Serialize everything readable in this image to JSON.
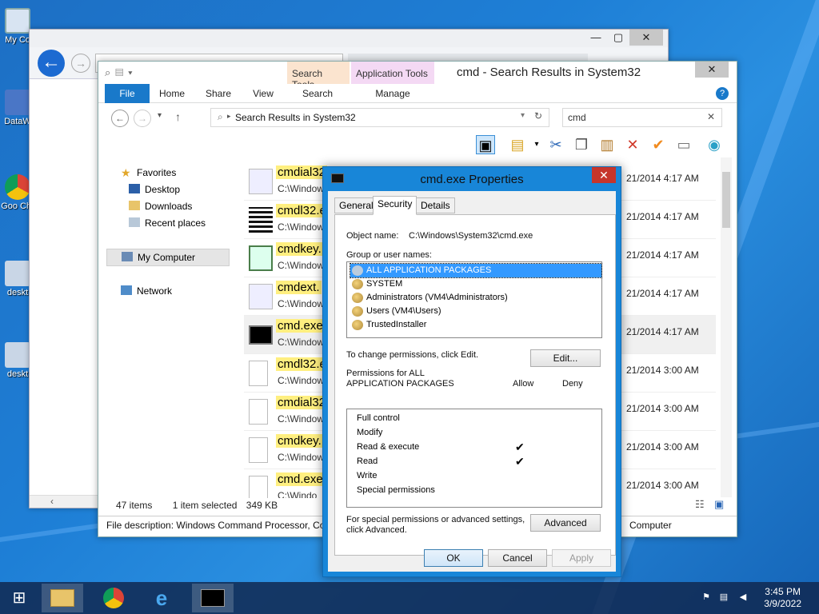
{
  "desktop": {
    "icons": [
      {
        "label": "My Co",
        "icon": "computer-icon"
      },
      {
        "label": "DataW",
        "icon": "datawarehouse-icon"
      },
      {
        "label": "Goo Chr",
        "icon": "chrome-icon"
      },
      {
        "label": "deskt",
        "icon": "desktop-file-icon"
      },
      {
        "label": "deskt",
        "icon": "desktop-file-icon"
      }
    ]
  },
  "browser": {
    "back_icon": "arrow-left-icon",
    "forward_icon": "arrow-right-icon"
  },
  "explorer": {
    "window_title": "cmd - Search Results in System32",
    "context_tabs": {
      "search_tools": "Search Tools",
      "application_tools": "Application Tools"
    },
    "ribbon_tabs": [
      "File",
      "Home",
      "Share",
      "View",
      "Search",
      "Manage"
    ],
    "address": "Search Results in System32",
    "search_value": "cmd",
    "nav": {
      "favorites": "Favorites",
      "desktop": "Desktop",
      "downloads": "Downloads",
      "recent": "Recent places",
      "my_computer": "My Computer",
      "network": "Network"
    },
    "files": [
      {
        "name": "cmdial32",
        "path": "C:\\Window",
        "date": "21/2014 4:17 AM",
        "icon": "gear-file-icon"
      },
      {
        "name": "cmdl32.e",
        "path": "C:\\Window",
        "date": "21/2014 4:17 AM",
        "icon": "phone-book-icon"
      },
      {
        "name": "cmdkey.",
        "path": "C:\\Window",
        "date": "21/2014 4:17 AM",
        "icon": "key-window-icon"
      },
      {
        "name": "cmdext.",
        "path": "C:\\Window",
        "date": "21/2014 4:17 AM",
        "icon": "gear-file-icon"
      },
      {
        "name": "cmd.exe",
        "path": "C:\\Window",
        "date": "21/2014 4:17 AM",
        "icon": "console-icon"
      },
      {
        "name": "cmdl32.e",
        "path": "C:\\Window",
        "date": "21/2014 3:00 AM",
        "icon": "blank-file-icon"
      },
      {
        "name": "cmdial32",
        "path": "C:\\Window",
        "date": "21/2014 3:00 AM",
        "icon": "blank-file-icon"
      },
      {
        "name": "cmdkey.",
        "path": "C:\\Window",
        "date": "21/2014 3:00 AM",
        "icon": "blank-file-icon"
      },
      {
        "name": "cmd.exe",
        "path": "C:\\Windo",
        "date": "21/2014 3:00 AM",
        "icon": "blank-file-icon"
      }
    ],
    "status": {
      "items": "47 items",
      "selected": "1 item selected",
      "size": "349 KB"
    },
    "description": "File description: Windows Command Processor, Co",
    "location": "Computer"
  },
  "dialog": {
    "title": "cmd.exe Properties",
    "tabs": [
      "General",
      "Security",
      "Details"
    ],
    "active_tab": "Security",
    "object_name_label": "Object name:",
    "object_name": "C:\\Windows\\System32\\cmd.exe",
    "group_label": "Group or user names:",
    "groups": [
      "ALL APPLICATION PACKAGES",
      "SYSTEM",
      "Administrators (VM4\\Administrators)",
      "Users (VM4\\Users)",
      "TrustedInstaller"
    ],
    "change_text": "To change permissions, click Edit.",
    "edit_label": "Edit...",
    "perm_for_line1": "Permissions for ALL",
    "perm_for_line2": "APPLICATION PACKAGES",
    "allow_label": "Allow",
    "deny_label": "Deny",
    "permissions": [
      {
        "name": "Full control",
        "allow": "",
        "deny": ""
      },
      {
        "name": "Modify",
        "allow": "",
        "deny": ""
      },
      {
        "name": "Read & execute",
        "allow": "✔",
        "deny": ""
      },
      {
        "name": "Read",
        "allow": "✔",
        "deny": ""
      },
      {
        "name": "Write",
        "allow": "",
        "deny": ""
      },
      {
        "name": "Special permissions",
        "allow": "",
        "deny": ""
      }
    ],
    "advanced_text1": "For special permissions or advanced settings,",
    "advanced_text2": "click Advanced.",
    "advanced_label": "Advanced",
    "ok_label": "OK",
    "cancel_label": "Cancel",
    "apply_label": "Apply"
  },
  "taskbar": {
    "clock_time": "3:45 PM",
    "clock_date": "3/9/2022"
  }
}
